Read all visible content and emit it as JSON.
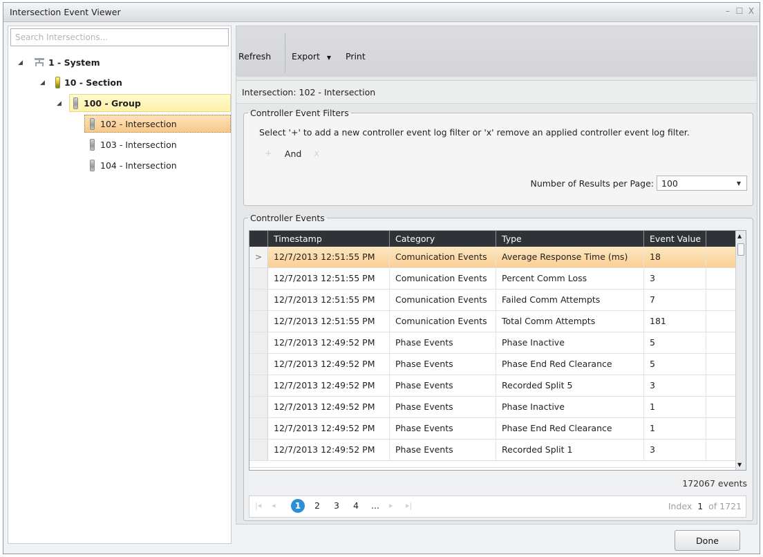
{
  "window": {
    "title": "Intersection Event Viewer",
    "controls": [
      "–",
      "☐",
      "X"
    ]
  },
  "tree": {
    "search_placeholder": "Search Intersections...",
    "nodes": [
      {
        "label": "1 - System"
      },
      {
        "label": "10 - Section"
      },
      {
        "label": "100 - Group"
      },
      {
        "label": "102 - Intersection"
      },
      {
        "label": "103 - Intersection"
      },
      {
        "label": "104 - Intersection"
      }
    ]
  },
  "toolbar": {
    "refresh": "Refresh",
    "export": "Export",
    "print": "Print"
  },
  "context": {
    "intersection": "Intersection: 102 - Intersection"
  },
  "filters": {
    "legend": "Controller Event Filters",
    "hint": "Select '+' to add a new controller event log filter or 'x' remove an applied controller event log filter.",
    "operator": "And",
    "results_label": "Number of Results per Page:",
    "results_value": "100"
  },
  "events": {
    "legend": "Controller Events",
    "columns": [
      "Timestamp",
      "Category",
      "Type",
      "Event Value"
    ],
    "rows": [
      {
        "timestamp": "12/7/2013 12:51:55 PM",
        "category": "Comunication Events",
        "type": "Average Response Time (ms)",
        "value": "18"
      },
      {
        "timestamp": "12/7/2013 12:51:55 PM",
        "category": "Comunication Events",
        "type": "Percent Comm Loss",
        "value": "3"
      },
      {
        "timestamp": "12/7/2013 12:51:55 PM",
        "category": "Comunication Events",
        "type": "Failed Comm Attempts",
        "value": "7"
      },
      {
        "timestamp": "12/7/2013 12:51:55 PM",
        "category": "Comunication Events",
        "type": "Total Comm Attempts",
        "value": "181"
      },
      {
        "timestamp": "12/7/2013 12:49:52 PM",
        "category": "Phase Events",
        "type": "Phase Inactive",
        "value": "5"
      },
      {
        "timestamp": "12/7/2013 12:49:52 PM",
        "category": "Phase Events",
        "type": "Phase End Red Clearance",
        "value": "5"
      },
      {
        "timestamp": "12/7/2013 12:49:52 PM",
        "category": "Phase Events",
        "type": "Recorded Split 5",
        "value": "3"
      },
      {
        "timestamp": "12/7/2013 12:49:52 PM",
        "category": "Phase Events",
        "type": "Phase Inactive",
        "value": "1"
      },
      {
        "timestamp": "12/7/2013 12:49:52 PM",
        "category": "Phase Events",
        "type": "Phase End Red Clearance",
        "value": "1"
      },
      {
        "timestamp": "12/7/2013 12:49:52 PM",
        "category": "Phase Events",
        "type": "Recorded Split 1",
        "value": "3"
      }
    ],
    "selected_marker": ">",
    "count": "172067 events"
  },
  "pager": {
    "pages": [
      "1",
      "2",
      "3",
      "4",
      "..."
    ],
    "index_label": "Index",
    "index_value": "1",
    "of_label": "of 1721"
  },
  "footer": {
    "done": "Done"
  },
  "colors": {
    "header_bg": "#2f3236",
    "selected_row": "#fbcf94",
    "selected_tree": "#f9c98a",
    "active_page": "#2c8fd6"
  }
}
